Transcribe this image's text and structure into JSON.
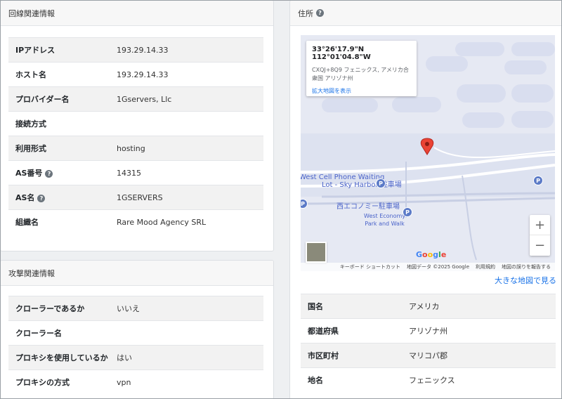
{
  "line_panel": {
    "title": "回線関連情報",
    "rows": [
      {
        "key": "IPアドレス",
        "value": "193.29.14.33"
      },
      {
        "key": "ホスト名",
        "value": "193.29.14.33"
      },
      {
        "key": "プロバイダー名",
        "value": "1Gservers, Llc"
      },
      {
        "key": "接続方式",
        "value": ""
      },
      {
        "key": "利用形式",
        "value": "hosting"
      },
      {
        "key": "AS番号",
        "value": "14315"
      },
      {
        "key": "AS名",
        "value": "1GSERVERS"
      },
      {
        "key": "組織名",
        "value": "Rare Mood Agency SRL"
      }
    ]
  },
  "attack_panel": {
    "title": "攻撃関連情報",
    "rows": [
      {
        "key": "クローラーであるか",
        "value": "いいえ"
      },
      {
        "key": "クローラー名",
        "value": ""
      },
      {
        "key": "プロキシを使用しているか",
        "value": "はい"
      },
      {
        "key": "プロキシの方式",
        "value": "vpn"
      }
    ]
  },
  "address_panel": {
    "title": "住所",
    "map": {
      "coords": "33°26'17.9\"N 112°01'04.8\"W",
      "address_line1": "CXQJ+8Q9 フェニックス, アメリカ合",
      "address_line2": "衆国 アリゾナ州",
      "view_larger": "拡大地図を表示",
      "label_cell_lot_1": "West Cell Phone Waiting",
      "label_cell_lot_2": "Lot - Sky Harbor",
      "label_cell_lot_jp": "駐車場",
      "label_economy_jp": "西エコノミー駐車場",
      "label_economy_1": "West Economy",
      "label_economy_2": "Park and Walk",
      "parking_letter": "P",
      "zoom_in": "+",
      "zoom_out": "−",
      "google": [
        "G",
        "o",
        "o",
        "g",
        "l",
        "e"
      ],
      "attrib_shortcuts": "キーボード ショートカット",
      "attrib_data": "地図データ ©2025 Google",
      "attrib_terms": "利用規約",
      "attrib_report": "地図の誤りを報告する"
    },
    "bigmap_link": "大きな地図で見る",
    "rows": [
      {
        "key": "国名",
        "value": "アメリカ"
      },
      {
        "key": "都道府県",
        "value": "アリゾナ州"
      },
      {
        "key": "市区町村",
        "value": "マリコパ郡"
      },
      {
        "key": "地名",
        "value": "フェニックス"
      }
    ]
  },
  "help_glyph": "?",
  "colors": {
    "link": "#1a73e8",
    "pin": "#ea4335",
    "parking": "#5b7ac7"
  }
}
